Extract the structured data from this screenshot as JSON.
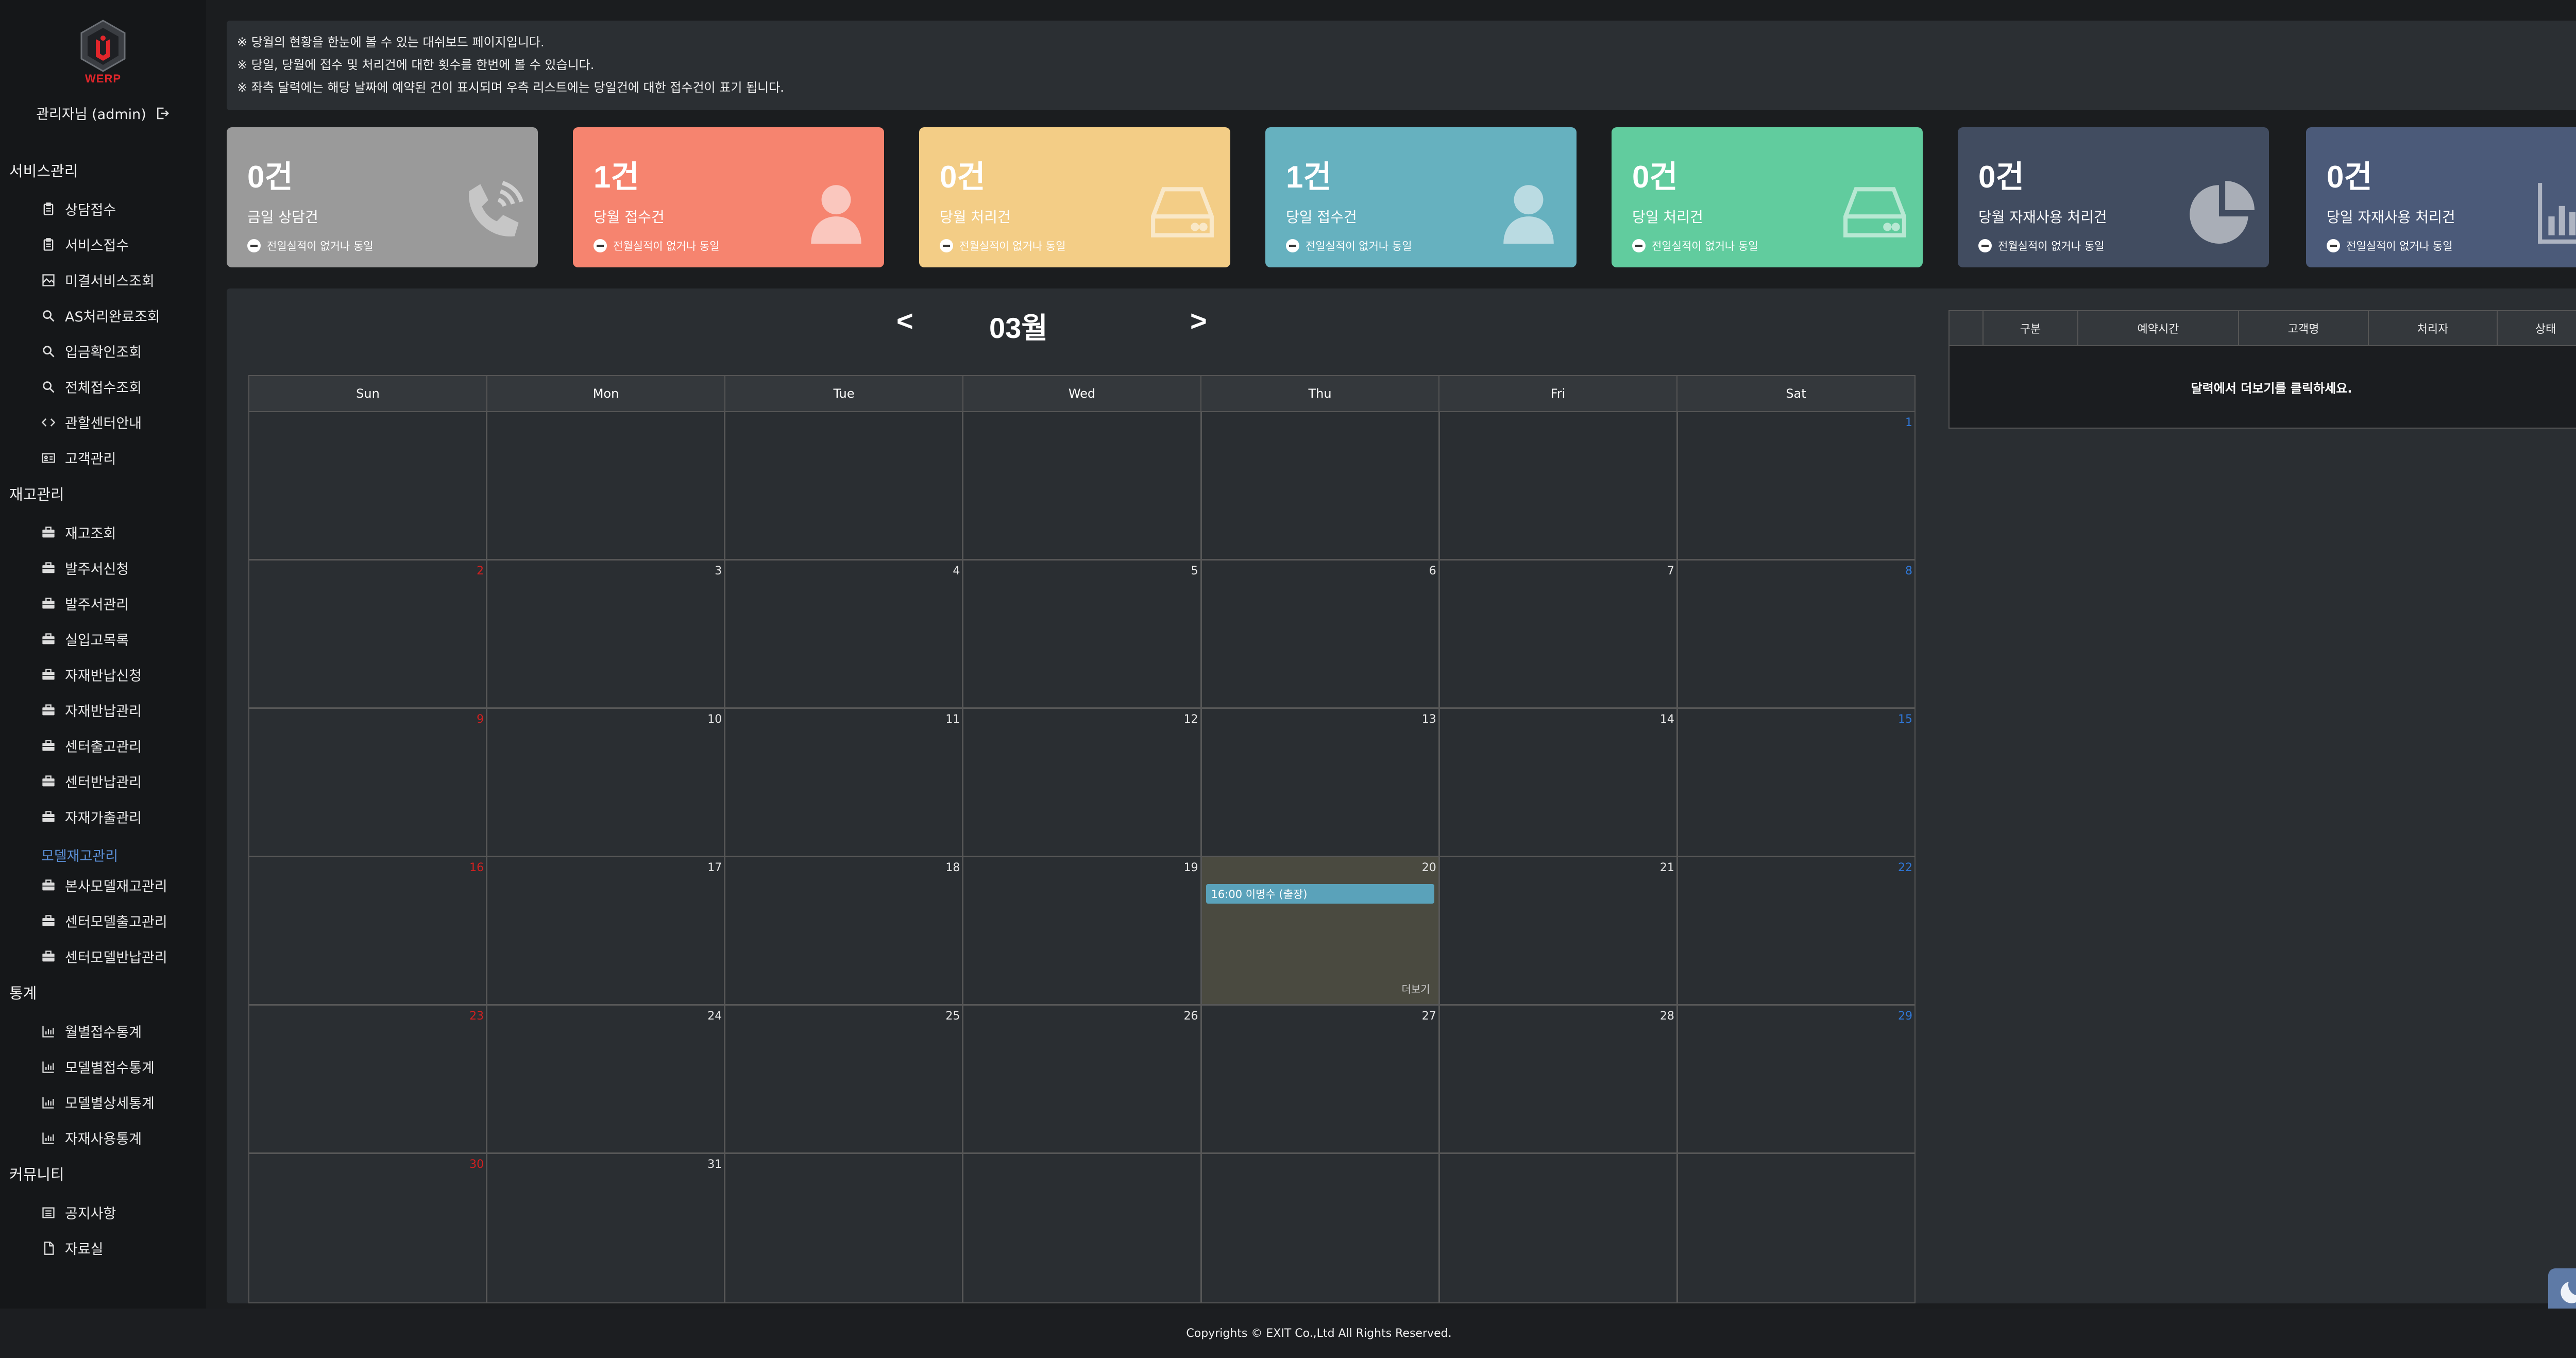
{
  "brand": {
    "logo_text": "WERP"
  },
  "user": {
    "name": "관리자님 (admin)"
  },
  "sidebar": {
    "groups": [
      {
        "title": "서비스관리",
        "items": [
          {
            "label": "상담접수",
            "icon": "clipboard-icon"
          },
          {
            "label": "서비스접수",
            "icon": "clipboard-icon"
          },
          {
            "label": "미결서비스조회",
            "icon": "image-icon"
          },
          {
            "label": "AS처리완료조회",
            "icon": "search-icon"
          },
          {
            "label": "입금확인조회",
            "icon": "search-icon"
          },
          {
            "label": "전체접수조회",
            "icon": "search-icon"
          },
          {
            "label": "관할센터안내",
            "icon": "code-icon"
          },
          {
            "label": "고객관리",
            "icon": "id-card-icon"
          }
        ]
      },
      {
        "title": "재고관리",
        "items": [
          {
            "label": "재고조회",
            "icon": "briefcase-icon"
          },
          {
            "label": "발주서신청",
            "icon": "briefcase-icon"
          },
          {
            "label": "발주서관리",
            "icon": "briefcase-icon"
          },
          {
            "label": "실입고목록",
            "icon": "briefcase-icon"
          },
          {
            "label": "자재반납신청",
            "icon": "briefcase-icon"
          },
          {
            "label": "자재반납관리",
            "icon": "briefcase-icon"
          },
          {
            "label": "센터출고관리",
            "icon": "briefcase-icon"
          },
          {
            "label": "센터반납관리",
            "icon": "briefcase-icon"
          },
          {
            "label": "자재가출관리",
            "icon": "briefcase-icon"
          }
        ],
        "sub_title": "모델재고관리",
        "sub_items": [
          {
            "label": "본사모델재고관리",
            "icon": "briefcase-icon"
          },
          {
            "label": "센터모델출고관리",
            "icon": "briefcase-icon"
          },
          {
            "label": "센터모델반납관리",
            "icon": "briefcase-icon"
          }
        ]
      },
      {
        "title": "통계",
        "items": [
          {
            "label": "월별접수통계",
            "icon": "bar-chart-icon"
          },
          {
            "label": "모델별접수통계",
            "icon": "bar-chart-icon"
          },
          {
            "label": "모델별상세통계",
            "icon": "bar-chart-icon"
          },
          {
            "label": "자재사용통계",
            "icon": "bar-chart-icon"
          }
        ]
      },
      {
        "title": "커뮤니티",
        "items": [
          {
            "label": "공지사항",
            "icon": "list-icon"
          },
          {
            "label": "자료실",
            "icon": "file-icon"
          }
        ]
      }
    ]
  },
  "notice": {
    "lines": [
      "※ 당월의 현황을 한눈에 볼 수 있는 대쉬보드 페이지입니다.",
      "※ 당일, 당월에 접수 및 처리건에 대한 횟수를 한번에 볼 수 있습니다.",
      "※ 좌측 달력에는 해당 날짜에 예약된 건이 표시되며 우측 리스트에는 당일건에 대한 접수건이 표기 됩니다."
    ]
  },
  "cards": [
    {
      "count": "0건",
      "label": "금일 상담건",
      "sub": "전일실적이 없거나 동일",
      "color": "#9a9a9a",
      "icon": "phone-icon"
    },
    {
      "count": "1건",
      "label": "당월 접수건",
      "sub": "전월실적이 없거나 동일",
      "color": "#f6846f",
      "icon": "user-icon"
    },
    {
      "count": "0건",
      "label": "당월 처리건",
      "sub": "전월실적이 없거나 동일",
      "color": "#f3cd86",
      "icon": "hdd-icon"
    },
    {
      "count": "1건",
      "label": "당일 접수건",
      "sub": "전일실적이 없거나 동일",
      "color": "#66b1bf",
      "icon": "user-icon"
    },
    {
      "count": "0건",
      "label": "당일 처리건",
      "sub": "전일실적이 없거나 동일",
      "color": "#61cc9e",
      "icon": "hdd-icon"
    },
    {
      "count": "0건",
      "label": "당월 자재사용 처리건",
      "sub": "전월실적이 없거나 동일",
      "color": "#414c60",
      "icon": "pie-chart-icon"
    },
    {
      "count": "0건",
      "label": "당일 자재사용 처리건",
      "sub": "전일실적이 없거나 동일",
      "color": "#4b5a79",
      "icon": "bar-chart-icon"
    }
  ],
  "calendar": {
    "month_title": "03월",
    "prev": "<",
    "next": ">",
    "weekdays": [
      "Sun",
      "Mon",
      "Tue",
      "Wed",
      "Thu",
      "Fri",
      "Sat"
    ],
    "weeks": [
      [
        "",
        "",
        "",
        "",
        "",
        "",
        "1"
      ],
      [
        "2",
        "3",
        "4",
        "5",
        "6",
        "7",
        "8"
      ],
      [
        "9",
        "10",
        "11",
        "12",
        "13",
        "14",
        "15"
      ],
      [
        "16",
        "17",
        "18",
        "19",
        "20",
        "21",
        "22"
      ],
      [
        "23",
        "24",
        "25",
        "26",
        "27",
        "28",
        "29"
      ],
      [
        "30",
        "31",
        "",
        "",
        "",
        "",
        ""
      ]
    ],
    "today": "20",
    "event": {
      "day": "20",
      "text": "16:00  이명수  (출장)"
    },
    "more_label": "더보기"
  },
  "side_table": {
    "headers": [
      "",
      "구분",
      "예약시간",
      "고객명",
      "처리자",
      "상태"
    ],
    "empty_message": "달력에서 더보기를 클릭하세요."
  },
  "footer": {
    "text": "Copyrights © EXIT Co.,Ltd All Rights Reserved."
  }
}
